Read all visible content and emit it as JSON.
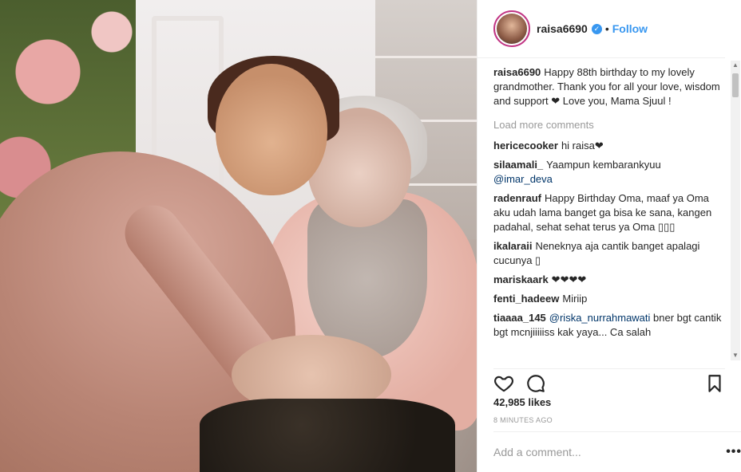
{
  "post": {
    "username": "raisa6690",
    "follow_label": "Follow",
    "dot": "•",
    "verified_glyph": "✓",
    "caption": "Happy 88th birthday to my lovely grandmother. Thank you for all your love, wisdom and support ❤ Love you, Mama Sjuul !",
    "load_more": "Load more comments",
    "likes": "42,985 likes",
    "time": "8 MINUTES AGO",
    "comment_placeholder": "Add a comment...",
    "more_glyph": "•••"
  },
  "comments": [
    {
      "user": "hericecooker",
      "text": "hi raisa❤"
    },
    {
      "user": "silaamali_",
      "text": "Yaampun kembarankyuu",
      "mention": "@imar_deva"
    },
    {
      "user": "radenrauf",
      "text": "Happy Birthday Oma, maaf ya Oma aku udah lama banget ga bisa ke sana, kangen padahal, sehat sehat terus ya Oma ▯▯▯"
    },
    {
      "user": "ikalaraii",
      "text": "Neneknya aja cantik banget apalagi cucunya ▯"
    },
    {
      "user": "mariskaark",
      "text": "❤❤❤❤"
    },
    {
      "user": "fenti_hadeew",
      "text": "Miriip"
    },
    {
      "user": "tiaaaa_145",
      "mention": "@riska_nurrahmawati",
      "text": "bner bgt cantik bgt mcnjiiiiiss kak yaya... Ca salah"
    }
  ],
  "icons": [
    "heart-icon",
    "comment-icon",
    "bookmark-icon"
  ],
  "colors": {
    "link": "#3897f0",
    "ring": "#c13584",
    "text": "#262626",
    "muted": "#999999"
  }
}
